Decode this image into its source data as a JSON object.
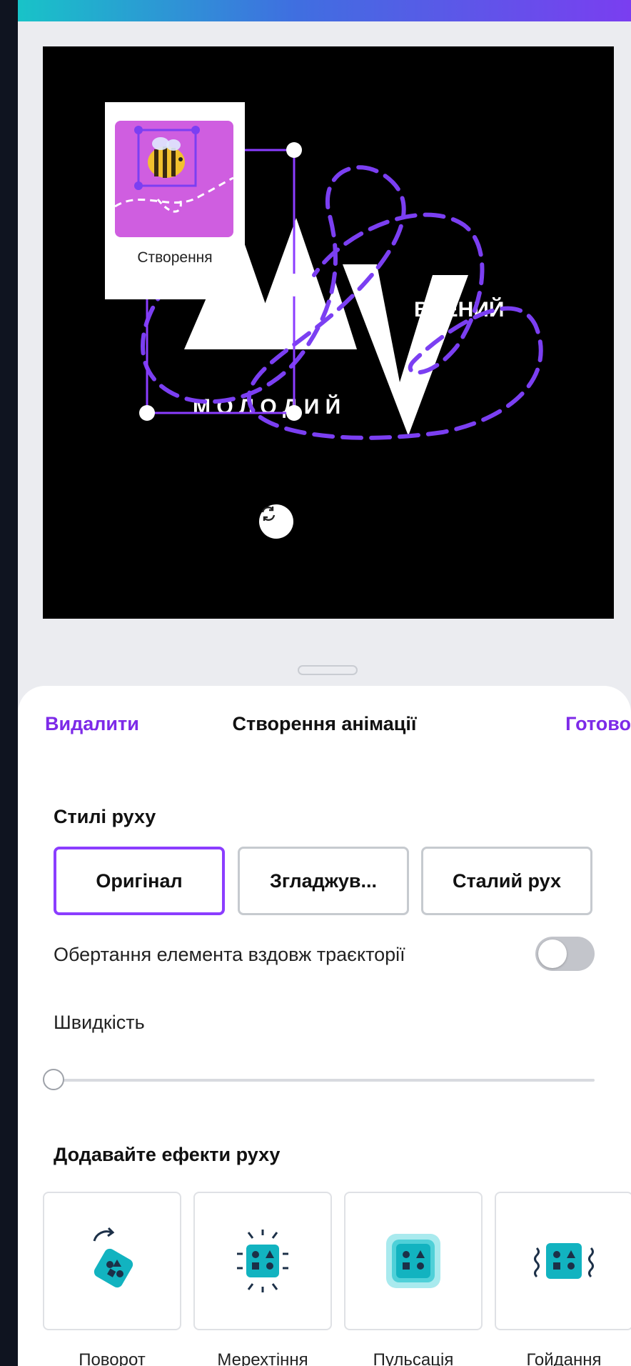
{
  "canvas": {
    "thumbnail_label": "Створення",
    "logo": {
      "word_right": "ВЧЕНИЙ",
      "word_bottom": "М О Л О Д И Й"
    }
  },
  "sheet": {
    "delete_label": "Видалити",
    "title": "Створення анімації",
    "done_label": "Готово",
    "motion_styles": {
      "title": "Стилі руху",
      "options": [
        "Оригінал",
        "Згладжув...",
        "Сталий рух"
      ],
      "selected": "Оригінал"
    },
    "rotate_along_path": {
      "label": "Обертання елемента вздовж траєкторії",
      "on": false
    },
    "speed": {
      "label": "Швидкість",
      "value": 0
    },
    "effects": {
      "title": "Додавайте ефекти руху",
      "items": [
        {
          "label": "Поворот",
          "icon": "rotate-effect-icon"
        },
        {
          "label": "Мерехтіння",
          "icon": "flicker-effect-icon"
        },
        {
          "label": "Пульсація",
          "icon": "pulse-effect-icon"
        },
        {
          "label": "Гойдання",
          "icon": "wiggle-effect-icon"
        }
      ]
    }
  },
  "colors": {
    "accent": "#7d2ae8",
    "path": "#7b3ff2",
    "thumbnail_bg": "#cf5ee0",
    "effect_tile": "#12b3c0"
  }
}
